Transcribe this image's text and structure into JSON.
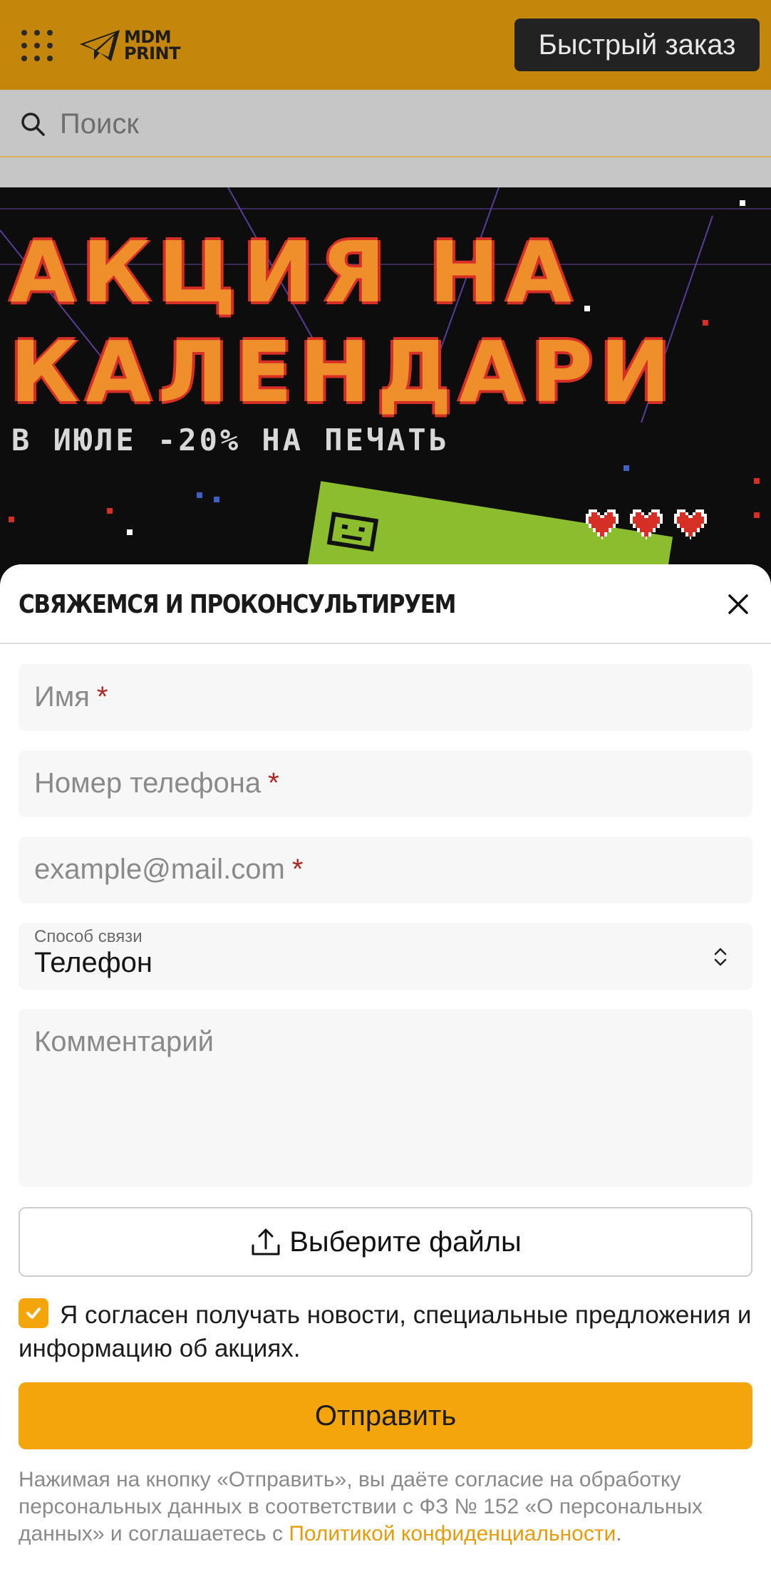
{
  "header": {
    "logo_line1": "MDM",
    "logo_line2": "PRINT",
    "quick_order_label": "Быстрый заказ",
    "menu_icon": "grid-menu-icon",
    "bg_color": "#c4870c"
  },
  "search": {
    "placeholder": "Поиск",
    "icon": "search-icon"
  },
  "banner": {
    "line1": "АКЦИЯ НА",
    "line2": "КАЛЕНДАРИ",
    "subtitle": "В ИЮЛЕ -20% НА ПЕЧАТЬ"
  },
  "modal": {
    "title": "СВЯЖЕМСЯ И ПРОКОНСУЛЬТИРУЕМ",
    "close_icon": "close-icon",
    "fields": {
      "name_placeholder": "Имя",
      "phone_placeholder": "Номер телефона",
      "email_placeholder": "example@mail.com",
      "required_mark": "*"
    },
    "contact_method": {
      "label": "Способ связи",
      "value": "Телефон"
    },
    "comment_placeholder": "Комментарий",
    "file_button_label": "Выберите файлы",
    "consent": {
      "checked": true,
      "text": "Я согласен получать новости, специальные предложения и информацию об акциях."
    },
    "submit_label": "Отправить",
    "legal": {
      "text": "Нажимая на кнопку «Отправить», вы даёте согласие на обработку персональных данных в соответствии с ФЗ № 152 «О персональных данных» и соглашаетесь с ",
      "link": "Политикой конфиденциальности",
      "end": "."
    },
    "accent_color": "#f4a50c"
  }
}
